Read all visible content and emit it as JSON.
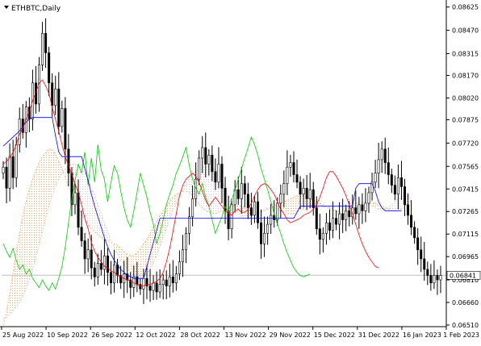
{
  "header": {
    "symbol_label": "ETHBTC,Daily",
    "arrow": "triangle-down-icon"
  },
  "chart_data": {
    "type": "candlestick",
    "title": "ETHBTC,Daily",
    "ylim": [
      0.0651,
      0.0865
    ],
    "yticks": [
      "0.08625",
      "0.08470",
      "0.08315",
      "0.08170",
      "0.08020",
      "0.07875",
      "0.07720",
      "0.07565",
      "0.07415",
      "0.07265",
      "0.07115",
      "0.06965",
      "0.06810",
      "0.06660",
      "0.06510"
    ],
    "xticks": [
      "25 Aug 2022",
      "10 Sep 2022",
      "26 Sep 2022",
      "12 Oct 2022",
      "28 Oct 2022",
      "13 Nov 2022",
      "29 Nov 2022",
      "15 Dec 2022",
      "31 Dec 2022",
      "16 Jan 2023",
      "1 Feb 2023"
    ],
    "current_price": "0.06841",
    "closes": [
      0.0756,
      0.0742,
      0.0763,
      0.0749,
      0.0771,
      0.0788,
      0.0779,
      0.0796,
      0.0788,
      0.0812,
      0.0798,
      0.0824,
      0.0845,
      0.0832,
      0.0812,
      0.0797,
      0.0808,
      0.0783,
      0.0795,
      0.0768,
      0.0752,
      0.0731,
      0.0739,
      0.0716,
      0.0707,
      0.0695,
      0.0701,
      0.0689,
      0.0683,
      0.0692,
      0.0688,
      0.0697,
      0.0686,
      0.0679,
      0.0691,
      0.0684,
      0.0679,
      0.0685,
      0.0681,
      0.0676,
      0.0683,
      0.0678,
      0.0675,
      0.0682,
      0.0677,
      0.0674,
      0.0679,
      0.0673,
      0.0678,
      0.0681,
      0.0677,
      0.0683,
      0.0679,
      0.0685,
      0.0693,
      0.0701,
      0.0712,
      0.0723,
      0.0735,
      0.0748,
      0.0762,
      0.0769,
      0.0758,
      0.0764,
      0.0753,
      0.0746,
      0.0758,
      0.0742,
      0.0727,
      0.0715,
      0.0731,
      0.0741,
      0.0735,
      0.0745,
      0.0738,
      0.0729,
      0.0724,
      0.0733,
      0.0719,
      0.0705,
      0.0712,
      0.0718,
      0.0724,
      0.0721,
      0.0732,
      0.0738,
      0.0745,
      0.0756,
      0.0759,
      0.0751,
      0.0746,
      0.0738,
      0.0742,
      0.0735,
      0.0741,
      0.0729,
      0.0715,
      0.0708,
      0.0712,
      0.0719,
      0.0714,
      0.0722,
      0.0718,
      0.0725,
      0.0721,
      0.0727,
      0.0723,
      0.0729,
      0.0725,
      0.0731,
      0.0727,
      0.0732,
      0.0739,
      0.0746,
      0.0752,
      0.0761,
      0.0768,
      0.0759,
      0.0751,
      0.0744,
      0.0738,
      0.0749,
      0.0743,
      0.0731,
      0.0724,
      0.0716,
      0.0709,
      0.0701,
      0.0695,
      0.0688,
      0.0684,
      0.0679,
      0.0684,
      0.0681,
      0.0684
    ],
    "indicator": "Ichimoku Kinko Hyo",
    "series_colors": {
      "tenkan": "#ff0000",
      "kijun": "#0000ff",
      "chikou": "#00cc00",
      "senkou_a": "#f4a460",
      "senkou_b": "#d8bfd8",
      "candle": "#000000",
      "price_line": "#c0c0c0"
    },
    "tenkan": [
      0.0758,
      0.076,
      0.0762,
      0.0766,
      0.0771,
      0.0778,
      0.0782,
      0.0788,
      0.0793,
      0.08,
      0.0806,
      0.0812,
      0.0814,
      0.081,
      0.0805,
      0.0796,
      0.0788,
      0.078,
      0.0771,
      0.0763,
      0.0757,
      0.0751,
      0.0745,
      0.0739,
      0.0731,
      0.0722,
      0.0715,
      0.0706,
      0.07,
      0.0696,
      0.0693,
      0.069,
      0.0689,
      0.0687,
      0.0686,
      0.0684,
      0.0683,
      0.0682,
      0.0681,
      0.068,
      0.0679,
      0.0678,
      0.0677,
      0.0677,
      0.0678,
      0.0678,
      0.0679,
      0.068,
      0.0682,
      0.0686,
      0.0693,
      0.0702,
      0.0713,
      0.0725,
      0.0737,
      0.0744,
      0.0748,
      0.075,
      0.0752,
      0.075,
      0.0746,
      0.074,
      0.0734,
      0.073,
      0.0733,
      0.0736,
      0.0733,
      0.073,
      0.0727,
      0.0725,
      0.0724,
      0.0727,
      0.0728,
      0.0726,
      0.0726,
      0.0728,
      0.0732,
      0.0737,
      0.0741,
      0.0744,
      0.0745,
      0.0744,
      0.0741,
      0.0738,
      0.0733,
      0.0728,
      0.0725,
      0.0721,
      0.0719,
      0.072,
      0.0721,
      0.0722,
      0.0724,
      0.0725,
      0.0726,
      0.0728,
      0.0731,
      0.0736,
      0.0742,
      0.0749,
      0.0753,
      0.0753,
      0.075,
      0.0746,
      0.0742,
      0.0737,
      0.0731,
      0.0725,
      0.0718,
      0.0711,
      0.0705,
      0.07,
      0.0696,
      0.0693,
      0.069,
      0.0689
    ],
    "kijun": [
      0.077,
      0.0772,
      0.0774,
      0.0776,
      0.0778,
      0.078,
      0.0783,
      0.0786,
      0.0788,
      0.0789,
      0.0789,
      0.0789,
      0.0789,
      0.0789,
      0.0789,
      0.0789,
      0.0777,
      0.0766,
      0.0763,
      0.0763,
      0.0763,
      0.0763,
      0.0763,
      0.0763,
      0.0763,
      0.0755,
      0.0747,
      0.0738,
      0.073,
      0.0723,
      0.0716,
      0.0709,
      0.0703,
      0.0698,
      0.0694,
      0.0691,
      0.0688,
      0.0686,
      0.0684,
      0.0683,
      0.0682,
      0.0682,
      0.0682,
      0.0682,
      0.069,
      0.0698,
      0.0706,
      0.0714,
      0.0722,
      0.0722,
      0.0722,
      0.0722,
      0.0722,
      0.0722,
      0.0722,
      0.0722,
      0.0722,
      0.0722,
      0.0722,
      0.0722,
      0.0722,
      0.0722,
      0.0722,
      0.0722,
      0.0722,
      0.0722,
      0.0722,
      0.0722,
      0.0722,
      0.0722,
      0.0722,
      0.0722,
      0.0722,
      0.0722,
      0.0722,
      0.0722,
      0.0722,
      0.0722,
      0.0722,
      0.0722,
      0.0722,
      0.0722,
      0.0722,
      0.0722,
      0.0722,
      0.0722,
      0.0722,
      0.0722,
      0.0722,
      0.0722,
      0.0726,
      0.073,
      0.073,
      0.073,
      0.073,
      0.073,
      0.073,
      0.073,
      0.073,
      0.073,
      0.073,
      0.073,
      0.073,
      0.073,
      0.073,
      0.073,
      0.073,
      0.073,
      0.0742,
      0.0745,
      0.0745,
      0.0745,
      0.0745,
      0.0745,
      0.074,
      0.0733,
      0.0729,
      0.0727,
      0.0727,
      0.0727,
      0.0727,
      0.0727,
      0.0727
    ],
    "chikou": [
      0.0705,
      0.07,
      0.0696,
      0.0702,
      0.0694,
      0.0688,
      0.0691,
      0.0685,
      0.0688,
      0.0682,
      0.0679,
      0.0676,
      0.0681,
      0.0677,
      0.0674,
      0.0679,
      0.0675,
      0.0682,
      0.069,
      0.0703,
      0.0719,
      0.0735,
      0.0747,
      0.0758,
      0.0752,
      0.0766,
      0.0744,
      0.0762,
      0.0746,
      0.0771,
      0.0754,
      0.0748,
      0.0733,
      0.0746,
      0.0757,
      0.0752,
      0.074,
      0.0729,
      0.0721,
      0.0716,
      0.0727,
      0.0739,
      0.0752,
      0.0744,
      0.0736,
      0.0726,
      0.0718,
      0.0705,
      0.0712,
      0.0721,
      0.0731,
      0.0738,
      0.0744,
      0.0752,
      0.0757,
      0.0763,
      0.0769,
      0.0757,
      0.0748,
      0.0742,
      0.0738,
      0.0745,
      0.0736,
      0.073,
      0.0721,
      0.0712,
      0.0718,
      0.0723,
      0.073,
      0.0726,
      0.0734,
      0.0741,
      0.0748,
      0.0755,
      0.0762,
      0.0769,
      0.0776,
      0.0771,
      0.0764,
      0.0755,
      0.0748,
      0.0741,
      0.0733,
      0.0725,
      0.0718,
      0.0712,
      0.0705,
      0.0699,
      0.0694,
      0.0689,
      0.0686,
      0.0684,
      0.0683,
      0.0684,
      0.0685
    ],
    "senkou_a": [
      0.0651,
      0.066,
      0.0672,
      0.0686,
      0.07,
      0.0712,
      0.0724,
      0.0733,
      0.0741,
      0.0748,
      0.0754,
      0.0759,
      0.0763,
      0.0766,
      0.0768,
      0.0768,
      0.0765,
      0.076,
      0.0755,
      0.0749,
      0.0743,
      0.0738,
      0.0733,
      0.0729,
      0.0725,
      0.0721,
      0.0718,
      0.0715,
      0.0713,
      0.0711,
      0.0709,
      0.0708,
      0.0707,
      0.0706,
      0.0705,
      0.0704,
      0.0702,
      0.07,
      0.0698,
      0.0697,
      0.0697,
      0.0699,
      0.0702,
      0.0705,
      0.0708,
      0.0712,
      0.0716,
      0.072,
      0.0724,
      0.0727,
      0.073,
      0.0733,
      0.0736,
      0.0738,
      0.0739,
      0.074,
      0.074,
      0.0739,
      0.0737,
      0.0734,
      0.0731,
      0.0729,
      0.0727,
      0.0726,
      0.0725,
      0.0725,
      0.0726,
      0.0727,
      0.0728,
      0.0729,
      0.073,
      0.073,
      0.073,
      0.073,
      0.0729,
      0.0728,
      0.0727,
      0.0726,
      0.0726,
      0.0726,
      0.0727,
      0.0728,
      0.0729,
      0.073,
      0.0731,
      0.0732,
      0.0733,
      0.0734,
      0.0735,
      0.0736,
      0.0737,
      0.0738,
      0.0737,
      0.0736,
      0.0735,
      0.0734,
      0.0733,
      0.0732,
      0.0731,
      0.073,
      0.0729,
      0.0728,
      0.0727,
      0.0726,
      0.0725,
      0.0724,
      0.0725,
      0.0727,
      0.0729,
      0.0731,
      0.0732,
      0.0733,
      0.0733,
      0.0733,
      0.0732,
      0.0731,
      0.073,
      0.0729,
      0.0728,
      0.0727,
      0.0727,
      0.0727,
      0.0728,
      0.073,
      0.0732,
      0.0734
    ],
    "senkou_b": [
      0.0655,
      0.0656,
      0.0658,
      0.066,
      0.0663,
      0.0666,
      0.067,
      0.0675,
      0.0681,
      0.0688,
      0.0696,
      0.0704,
      0.0713,
      0.0722,
      0.073,
      0.0737,
      0.0743,
      0.0748,
      0.0752,
      0.0755,
      0.0757,
      0.0758,
      0.0758,
      0.0757,
      0.0755,
      0.0752,
      0.0748,
      0.0743,
      0.0737,
      0.0731,
      0.0725,
      0.0719,
      0.0713,
      0.0707,
      0.0702,
      0.0698,
      0.0694,
      0.0691,
      0.0688,
      0.0686,
      0.0684,
      0.0683,
      0.0682,
      0.0683,
      0.0685,
      0.0688,
      0.0692,
      0.0697,
      0.0703,
      0.0709,
      0.0715,
      0.0721,
      0.0727,
      0.0732,
      0.0737,
      0.0741,
      0.0745,
      0.0748,
      0.0751,
      0.0753,
      0.0755,
      0.0756,
      0.0757,
      0.0757,
      0.0756,
      0.0754,
      0.0751,
      0.0747,
      0.0742,
      0.0737,
      0.0732,
      0.0728,
      0.0725,
      0.0723,
      0.0722,
      0.0722,
      0.0723,
      0.0724,
      0.0726,
      0.0727,
      0.0728,
      0.0729,
      0.0729,
      0.0729,
      0.0728,
      0.0727,
      0.0726,
      0.0725,
      0.0725,
      0.0725,
      0.0726,
      0.0727,
      0.0728,
      0.0729,
      0.073,
      0.0731,
      0.0731,
      0.0731,
      0.073,
      0.0729,
      0.0728,
      0.0727,
      0.0727,
      0.0727,
      0.0728,
      0.0729,
      0.073,
      0.0731,
      0.0732,
      0.0733,
      0.0733,
      0.0732,
      0.0731,
      0.073,
      0.0729,
      0.0728,
      0.0728,
      0.0728,
      0.0729,
      0.0731,
      0.0733,
      0.0735,
      0.0736,
      0.0737,
      0.0737,
      0.0736
    ]
  }
}
